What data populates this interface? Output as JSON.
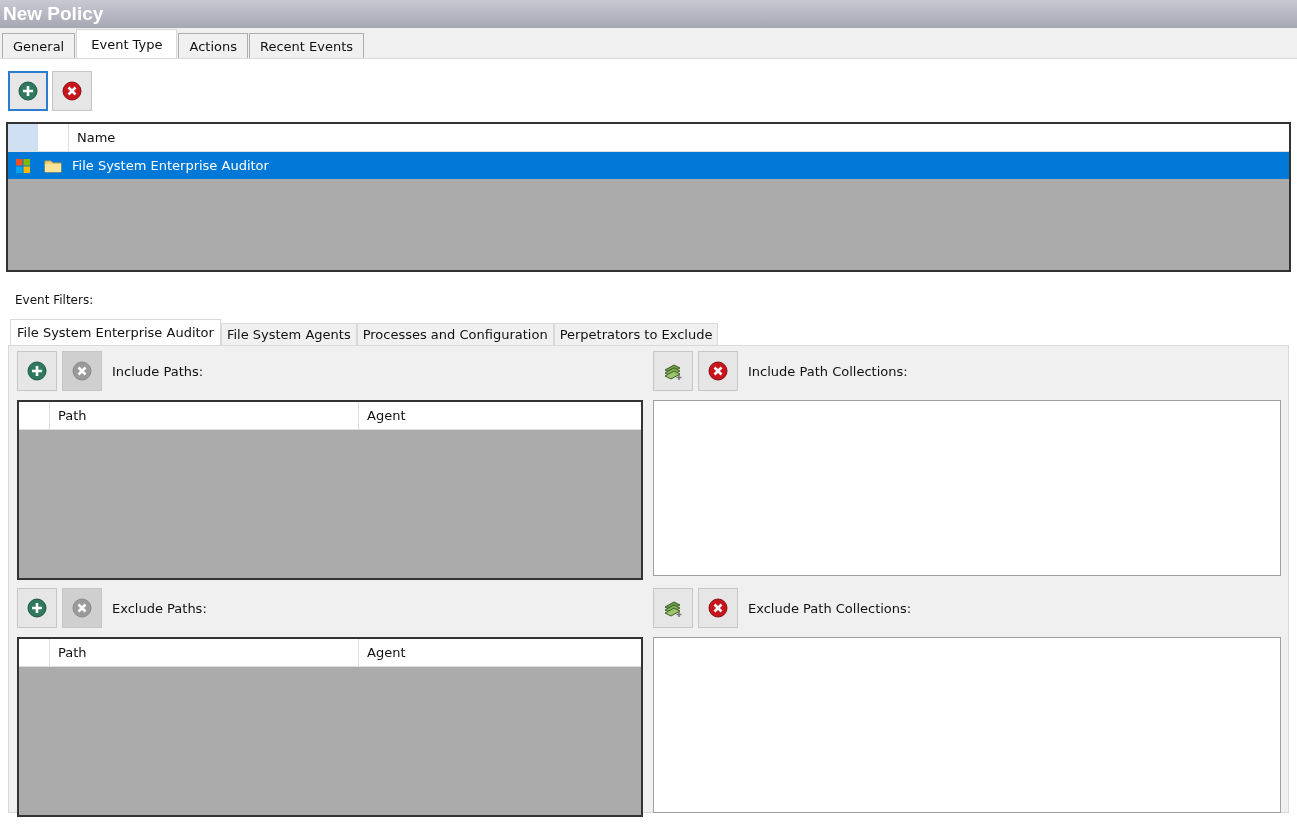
{
  "window": {
    "title": "New Policy"
  },
  "tabs": [
    {
      "label": "General",
      "selected": false
    },
    {
      "label": "Event Type",
      "selected": true
    },
    {
      "label": "Actions",
      "selected": false
    },
    {
      "label": "Recent Events",
      "selected": false
    }
  ],
  "toolbar": [
    {
      "kind": "add",
      "disabled": false,
      "focused": true
    },
    {
      "kind": "remove",
      "disabled": false,
      "focused": false
    }
  ],
  "event_types": {
    "columns": [
      "Name"
    ],
    "rows": [
      {
        "name": "File System Enterprise Auditor",
        "selected": true
      }
    ]
  },
  "event_filters": {
    "label": "Event Filters:",
    "tabs": [
      {
        "label": "File System Enterprise Auditor",
        "selected": true
      },
      {
        "label": "File System Agents",
        "selected": false
      },
      {
        "label": "Processes and Configuration",
        "selected": false
      },
      {
        "label": "Perpetrators to Exclude",
        "selected": false
      }
    ],
    "sections": [
      {
        "paths": {
          "label": "Include Paths:",
          "buttons": [
            {
              "kind": "add",
              "disabled": false
            },
            {
              "kind": "remove",
              "disabled": true
            }
          ],
          "columns": [
            "Path",
            "Agent"
          ]
        },
        "collections": {
          "label": "Include Path Collections:",
          "buttons": [
            {
              "kind": "add-collection",
              "disabled": false
            },
            {
              "kind": "remove",
              "disabled": false
            }
          ]
        }
      },
      {
        "paths": {
          "label": "Exclude Paths:",
          "buttons": [
            {
              "kind": "add",
              "disabled": false
            },
            {
              "kind": "remove",
              "disabled": true
            }
          ],
          "columns": [
            "Path",
            "Agent"
          ]
        },
        "collections": {
          "label": "Exclude Path Collections:",
          "buttons": [
            {
              "kind": "add-collection",
              "disabled": false
            },
            {
              "kind": "remove",
              "disabled": false
            }
          ]
        }
      }
    ]
  }
}
